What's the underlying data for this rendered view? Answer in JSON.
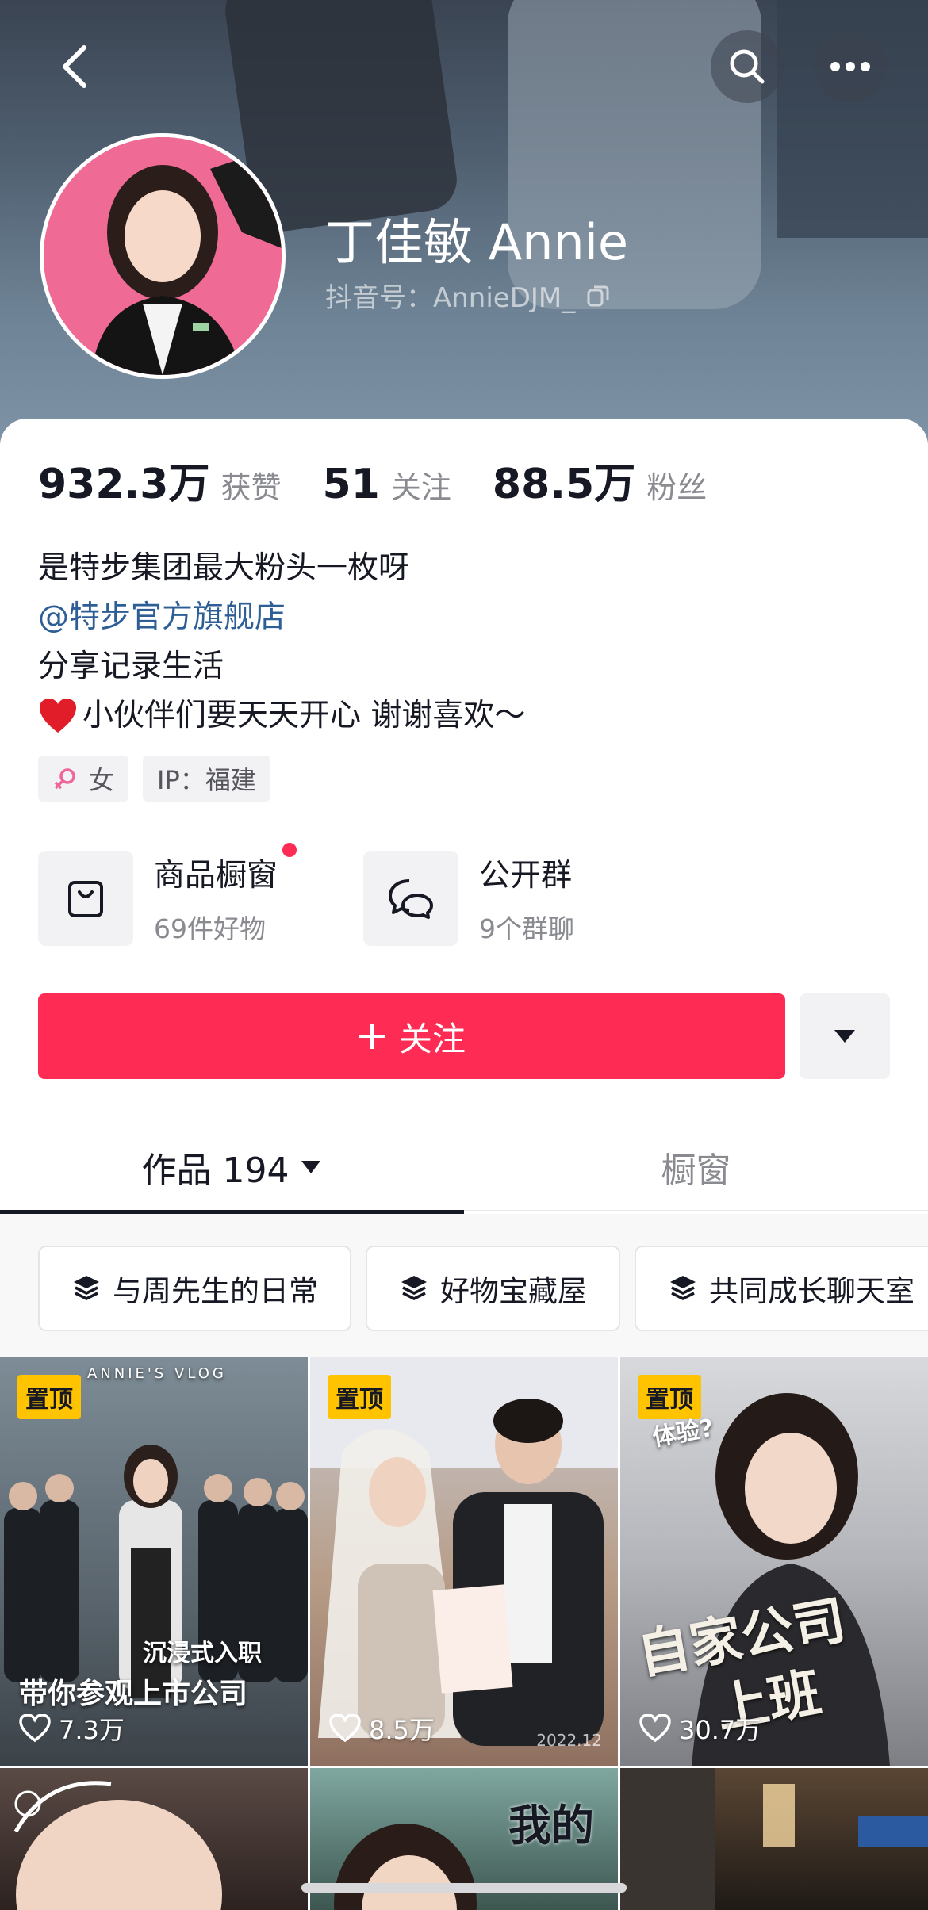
{
  "profile": {
    "name": "丁佳敏 Annie",
    "douyin_id": "抖音号：AnnieDJM_"
  },
  "stats": [
    {
      "value": "932.3万",
      "label": "获赞"
    },
    {
      "value": "51",
      "label": "关注"
    },
    {
      "value": "88.5万",
      "label": "粉丝"
    }
  ],
  "bio": {
    "line1": "是特步集团最大粉头一枚呀",
    "mention": "@特步官方旗舰店",
    "line3": "分享记录生活",
    "line4": "小伙伴们要天天开心 谢谢喜欢～"
  },
  "tags": {
    "gender": "女",
    "ip": "IP：福建"
  },
  "features": {
    "shop_title": "商品橱窗",
    "shop_sub": "69件好物",
    "group_title": "公开群",
    "group_sub": "9个群聊"
  },
  "follow_label": "关注",
  "tabs": {
    "works": "作品 194",
    "showcase": "橱窗"
  },
  "collections": [
    "与周先生的日常",
    "好物宝藏屋",
    "共同成长聊天室"
  ],
  "videos": [
    {
      "pinned": "置顶",
      "likes": "7.3万",
      "caption1": "沉浸式入职",
      "caption2": "带你参观上市公司",
      "header": "ANNIE'S VLOG"
    },
    {
      "pinned": "置顶",
      "likes": "8.5万",
      "stamp": "2022.12"
    },
    {
      "pinned": "置顶",
      "likes": "30.7万",
      "caption1": "自家公司",
      "caption2": "上班",
      "bubble": "体验?"
    },
    {
      "caption1": "我的"
    }
  ],
  "colors": {
    "accent": "#fe2c55",
    "pin": "#ffc300",
    "mention": "#2d5e95"
  }
}
